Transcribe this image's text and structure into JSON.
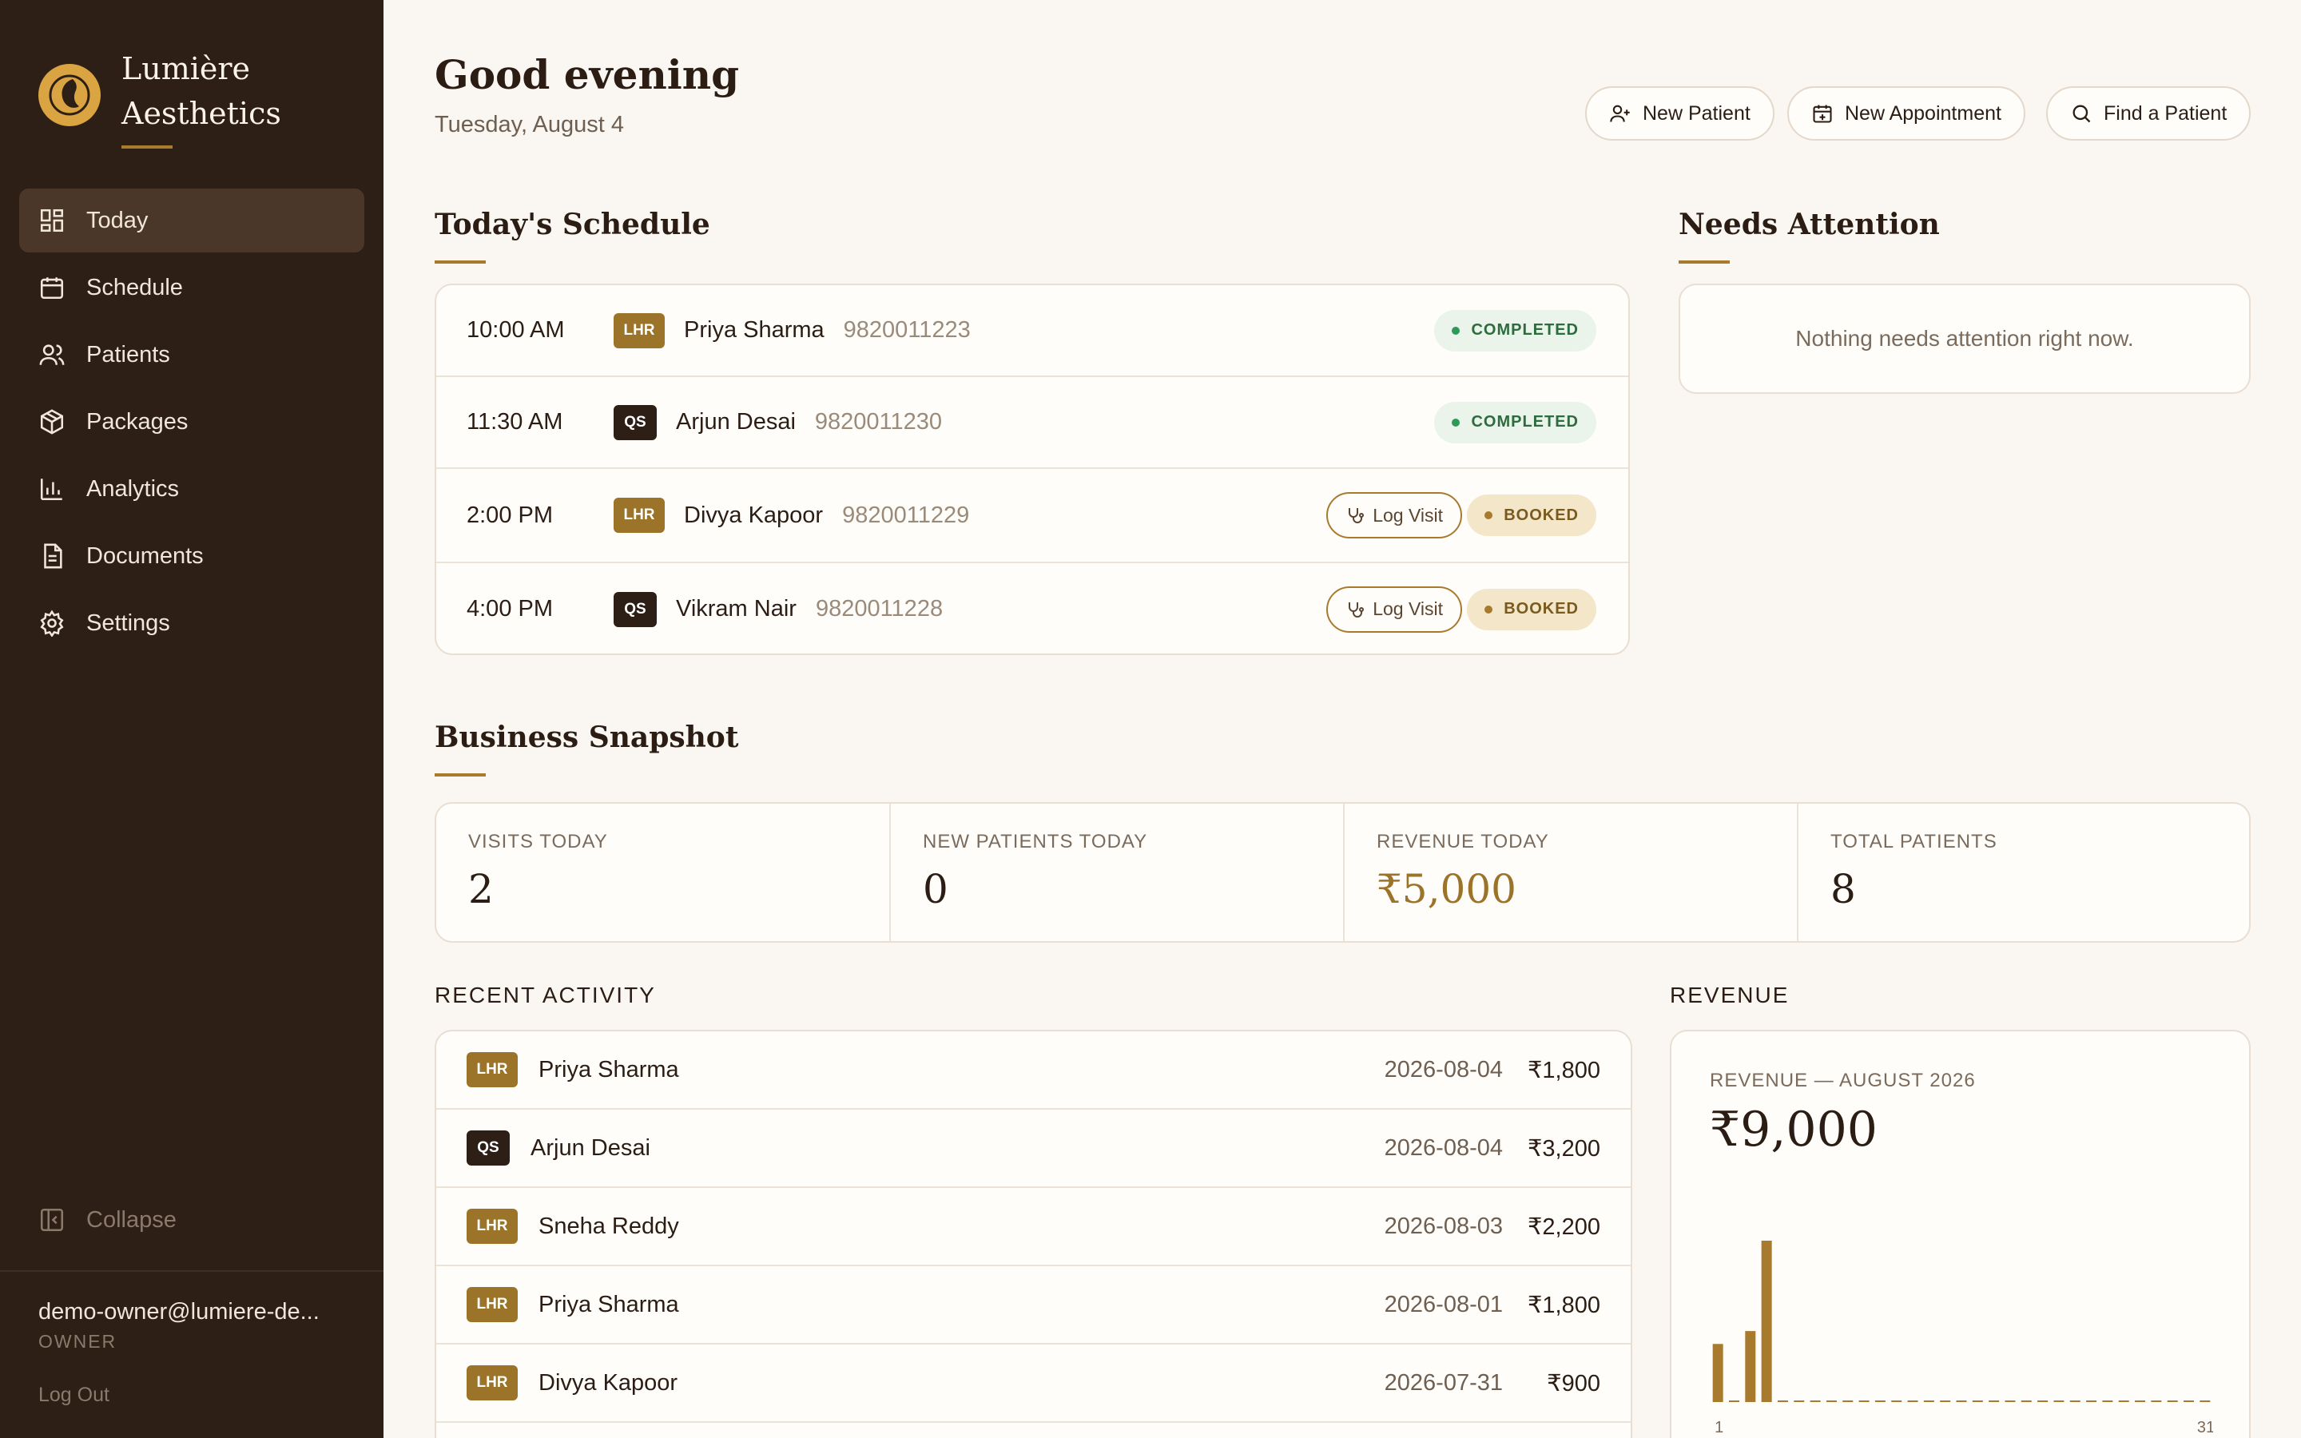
{
  "brand": {
    "line1": "Lumière",
    "line2": "Aesthetics"
  },
  "nav": [
    {
      "label": "Today",
      "icon": "dashboard-icon",
      "active": true
    },
    {
      "label": "Schedule",
      "icon": "calendar-icon"
    },
    {
      "label": "Patients",
      "icon": "users-icon"
    },
    {
      "label": "Packages",
      "icon": "package-icon"
    },
    {
      "label": "Analytics",
      "icon": "bar-chart-icon"
    },
    {
      "label": "Documents",
      "icon": "document-icon"
    },
    {
      "label": "Settings",
      "icon": "gear-icon"
    }
  ],
  "sidebar": {
    "collapse_label": "Collapse"
  },
  "user": {
    "email": "demo-owner@lumiere-de...",
    "role": "OWNER",
    "logout_label": "Log Out"
  },
  "header": {
    "greeting": "Good evening",
    "date": "Tuesday, August 4",
    "new_patient_label": "New Patient",
    "new_appointment_label": "New Appointment",
    "find_patient_label": "Find a Patient"
  },
  "schedule": {
    "title": "Today's Schedule",
    "log_visit_label": "Log Visit",
    "rows": [
      {
        "time": "10:00 AM",
        "tag": "LHR",
        "name": "Priya Sharma",
        "phone": "9820011223",
        "status": "COMPLETED"
      },
      {
        "time": "11:30 AM",
        "tag": "QS",
        "name": "Arjun Desai",
        "phone": "9820011230",
        "status": "COMPLETED"
      },
      {
        "time": "2:00 PM",
        "tag": "LHR",
        "name": "Divya Kapoor",
        "phone": "9820011229",
        "status": "BOOKED"
      },
      {
        "time": "4:00 PM",
        "tag": "QS",
        "name": "Vikram Nair",
        "phone": "9820011228",
        "status": "BOOKED"
      }
    ]
  },
  "attention": {
    "title": "Needs Attention",
    "empty_text": "Nothing needs attention right now."
  },
  "snapshot": {
    "title": "Business Snapshot",
    "kpis": [
      {
        "label": "VISITS TODAY",
        "value": "2"
      },
      {
        "label": "NEW PATIENTS TODAY",
        "value": "0"
      },
      {
        "label": "REVENUE TODAY",
        "value": "₹5,000"
      },
      {
        "label": "TOTAL PATIENTS",
        "value": "8"
      }
    ]
  },
  "activity": {
    "title": "RECENT ACTIVITY",
    "rows": [
      {
        "tag": "LHR",
        "name": "Priya Sharma",
        "date": "2026-08-04",
        "amount": "₹1,800"
      },
      {
        "tag": "QS",
        "name": "Arjun Desai",
        "date": "2026-08-04",
        "amount": "₹3,200"
      },
      {
        "tag": "LHR",
        "name": "Sneha Reddy",
        "date": "2026-08-03",
        "amount": "₹2,200"
      },
      {
        "tag": "LHR",
        "name": "Priya Sharma",
        "date": "2026-08-01",
        "amount": "₹1,800"
      },
      {
        "tag": "LHR",
        "name": "Divya Kapoor",
        "date": "2026-07-31",
        "amount": "₹900"
      }
    ]
  },
  "revenue": {
    "title": "REVENUE",
    "label": "REVENUE — AUGUST 2026",
    "total": "₹9,000"
  },
  "chart_data": {
    "type": "bar",
    "title": "REVENUE — AUGUST 2026",
    "x": [
      1,
      2,
      3,
      4,
      5,
      6,
      7,
      8,
      9,
      10,
      11,
      12,
      13,
      14,
      15,
      16,
      17,
      18,
      19,
      20,
      21,
      22,
      23,
      24,
      25,
      26,
      27,
      28,
      29,
      30,
      31
    ],
    "values": [
      1800,
      0,
      2200,
      5000,
      0,
      0,
      0,
      0,
      0,
      0,
      0,
      0,
      0,
      0,
      0,
      0,
      0,
      0,
      0,
      0,
      0,
      0,
      0,
      0,
      0,
      0,
      0,
      0,
      0,
      0,
      0
    ],
    "tick_labels": [
      "1",
      "31"
    ],
    "ylim": [
      0,
      5000
    ],
    "bar_color": "#a87a2d",
    "grid": false,
    "legend": "none"
  },
  "colors": {
    "sidebar_bg": "#2d1f16",
    "accent": "#a87a2d",
    "page_bg": "#faf7f2"
  }
}
